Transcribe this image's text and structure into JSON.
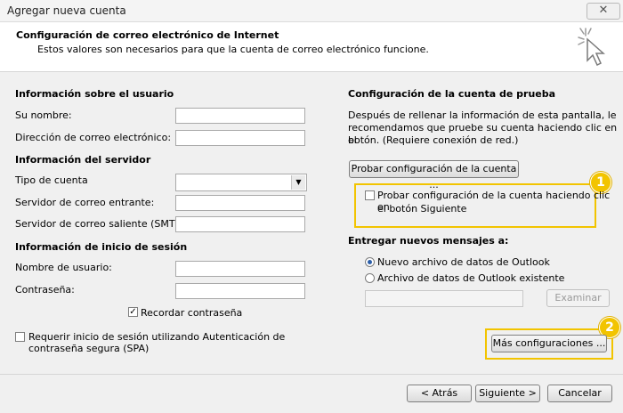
{
  "window": {
    "title": "Agregar nueva cuenta",
    "close_glyph": "✕"
  },
  "header": {
    "title": "Configuración de correo electrónico de Internet",
    "subtitle": "Estos valores son necesarios para que la cuenta de correo electrónico funcione."
  },
  "user_info": {
    "heading": "Información sobre el usuario",
    "name_label": "Su nombre:",
    "name_value": "",
    "email_label": "Dirección de correo electrónico:",
    "email_value": ""
  },
  "server_info": {
    "heading": "Información del servidor",
    "account_type_label": "Tipo de cuenta",
    "account_type_value": "",
    "incoming_label": "Servidor de correo entrante:",
    "incoming_value": "",
    "outgoing_label": "Servidor de correo saliente (SMTP):",
    "outgoing_value": ""
  },
  "login_info": {
    "heading": "Información de inicio de sesión",
    "username_label": "Nombre de usuario:",
    "username_value": "",
    "password_label": "Contraseña:",
    "password_value": "",
    "remember_label": "Recordar contraseña",
    "remember_checked": true,
    "spa_label_1": "Requerir inicio de sesión utilizando Autenticación de",
    "spa_label_2": "contraseña segura (SPA)",
    "spa_checked": false
  },
  "test_config": {
    "heading": "Configuración de la cuenta de prueba",
    "desc_1": "Después de rellenar la información de esta pantalla, le",
    "desc_2": "recomendamos que pruebe su cuenta haciendo clic en el",
    "desc_3": "botón. (Requiere conexión de red.)",
    "test_button": "Probar configuración de la cuenta ...",
    "test_on_next_1": "Probar configuración de la cuenta haciendo clic en",
    "test_on_next_2": "el botón Siguiente",
    "test_on_next_checked": false
  },
  "deliver": {
    "heading": "Entregar nuevos mensajes a:",
    "option_new": "Nuevo archivo de datos de Outlook",
    "option_existing": "Archivo de datos de Outlook existente",
    "selected": "new",
    "path_value": "",
    "browse_button": "Examinar"
  },
  "more_settings_button": "Más configuraciones ...",
  "callouts": {
    "one": "1",
    "two": "2",
    "color": "#f2c400"
  },
  "footer": {
    "back": "< Atrás",
    "next": "Siguiente >",
    "cancel": "Cancelar"
  }
}
